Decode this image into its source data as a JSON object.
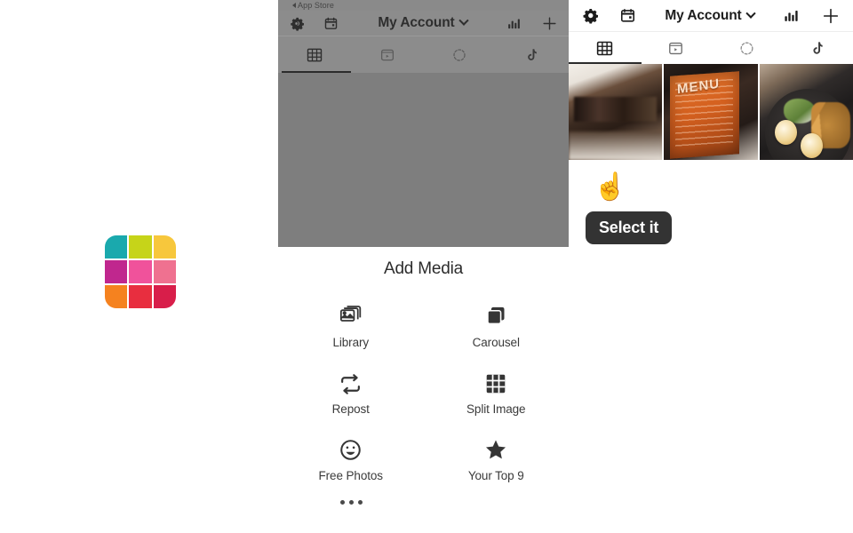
{
  "app_icon": {
    "name": "app-icon-grid",
    "colors": [
      "#1aa9ad",
      "#c6d419",
      "#f7c73c",
      "#c0278e",
      "#f0529b",
      "#ef7190",
      "#f5821f",
      "#e82e3f",
      "#d81e4a"
    ]
  },
  "middle_panel": {
    "status_bar": {
      "back_label": "App Store"
    },
    "header": {
      "gear_icon": "gear-icon",
      "calendar_icon": "calendar-icon",
      "title": "My Account",
      "chevron_icon": "chevron-down-icon",
      "insights_icon": "bar-chart-icon",
      "add_icon": "plus-icon"
    },
    "tabs": [
      {
        "name": "grid",
        "icon": "grid-icon",
        "active": true
      },
      {
        "name": "reels",
        "icon": "reels-icon",
        "active": false
      },
      {
        "name": "story",
        "icon": "story-circle-icon",
        "active": false
      },
      {
        "name": "tiktok",
        "icon": "tiktok-icon",
        "active": false
      }
    ],
    "sheet": {
      "title": "Add Media",
      "items": [
        {
          "label": "Library",
          "icon": "photo-stack-icon"
        },
        {
          "label": "Carousel",
          "icon": "stacked-squares-icon"
        },
        {
          "label": "Repost",
          "icon": "repeat-arrows-icon"
        },
        {
          "label": "Split Image",
          "icon": "split-grid-icon"
        },
        {
          "label": "Free Photos",
          "icon": "smiley-face-icon"
        },
        {
          "label": "Your Top 9",
          "icon": "star-icon"
        }
      ],
      "more_icon": "ellipsis-icon"
    }
  },
  "right_panel": {
    "header": {
      "gear_icon": "gear-icon",
      "calendar_icon": "calendar-icon",
      "title": "My Account",
      "chevron_icon": "chevron-down-icon",
      "insights_icon": "bar-chart-icon",
      "add_icon": "plus-icon"
    },
    "tabs": [
      {
        "name": "grid",
        "icon": "grid-icon",
        "active": true
      },
      {
        "name": "reels",
        "icon": "reels-icon",
        "active": false
      },
      {
        "name": "story",
        "icon": "story-circle-icon",
        "active": false
      },
      {
        "name": "tiktok",
        "icon": "tiktok-icon",
        "active": false
      }
    ],
    "photos": [
      {
        "alt": "cafe-interior-photo"
      },
      {
        "alt": "menu-board-photo",
        "caption": "MENU"
      },
      {
        "alt": "food-plate-photo"
      }
    ],
    "callout": {
      "hand_icon": "pointing-up-hand-icon",
      "hand_glyph": "☝",
      "tooltip_text": "Select it",
      "tooltip_bg": "#333333",
      "tooltip_color": "#ffffff"
    }
  }
}
